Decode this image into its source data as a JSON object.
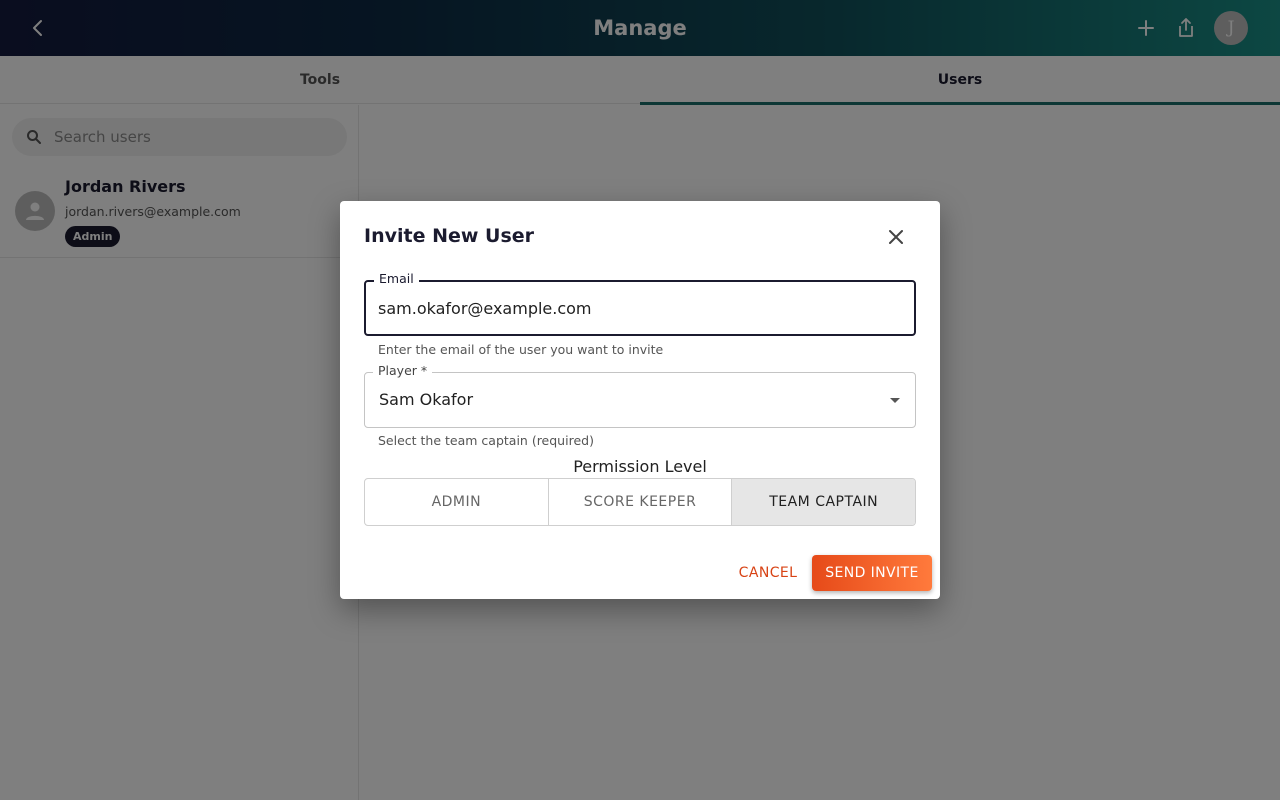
{
  "header": {
    "title": "Manage",
    "avatar_initial": "J",
    "icons": {
      "back": "arrow-back-icon",
      "add": "plus-icon",
      "share": "share-icon"
    }
  },
  "tabs": [
    {
      "label": "Tools",
      "active": false
    },
    {
      "label": "Users",
      "active": true
    }
  ],
  "sidebar": {
    "search_placeholder": "Search users",
    "users": [
      {
        "name": "Jordan Rivers",
        "email": "jordan.rivers@example.com",
        "badge": "Admin"
      }
    ]
  },
  "dialog": {
    "title": "Invite New User",
    "email": {
      "label": "Email",
      "value": "sam.okafor@example.com",
      "helper": "Enter the email of the user you want to invite"
    },
    "player": {
      "label": "Player *",
      "value": "Sam Okafor",
      "helper": "Select the team captain (required)"
    },
    "permission": {
      "label": "Permission Level",
      "options": [
        "ADMIN",
        "SCORE KEEPER",
        "TEAM CAPTAIN"
      ],
      "selected": "TEAM CAPTAIN"
    },
    "cancel_label": "CANCEL",
    "send_label": "SEND INVITE"
  },
  "colors": {
    "accent_orange": "#e64a19",
    "tab_indicator": "#1a6f6b",
    "navy": "#1b1b2f"
  }
}
